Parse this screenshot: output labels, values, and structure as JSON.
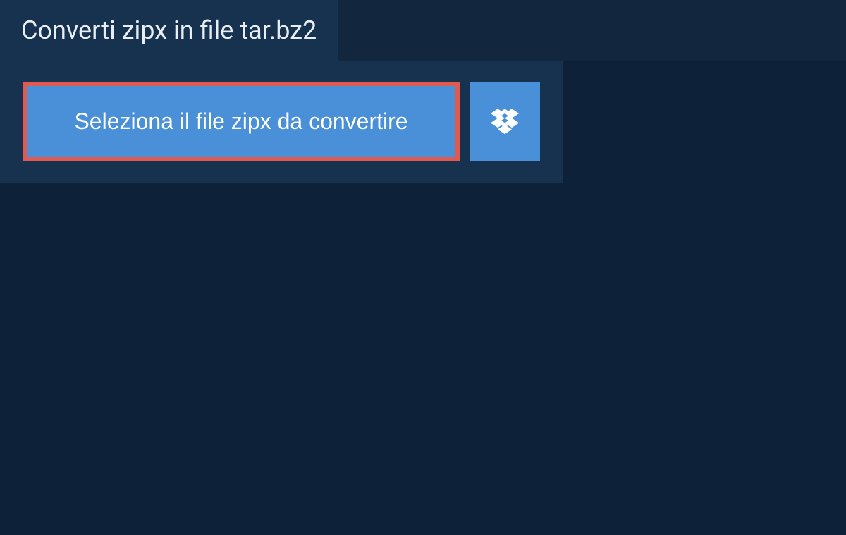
{
  "header": {
    "title": "Converti zipx in file tar.bz2"
  },
  "main": {
    "select_button_label": "Seleziona il file zipx da convertire"
  },
  "colors": {
    "background_dark": "#0d2238",
    "background_header": "#12263d",
    "panel": "#16324f",
    "button_primary": "#4a90d9",
    "button_highlight_border": "#e05a4f",
    "text": "#ffffff"
  }
}
